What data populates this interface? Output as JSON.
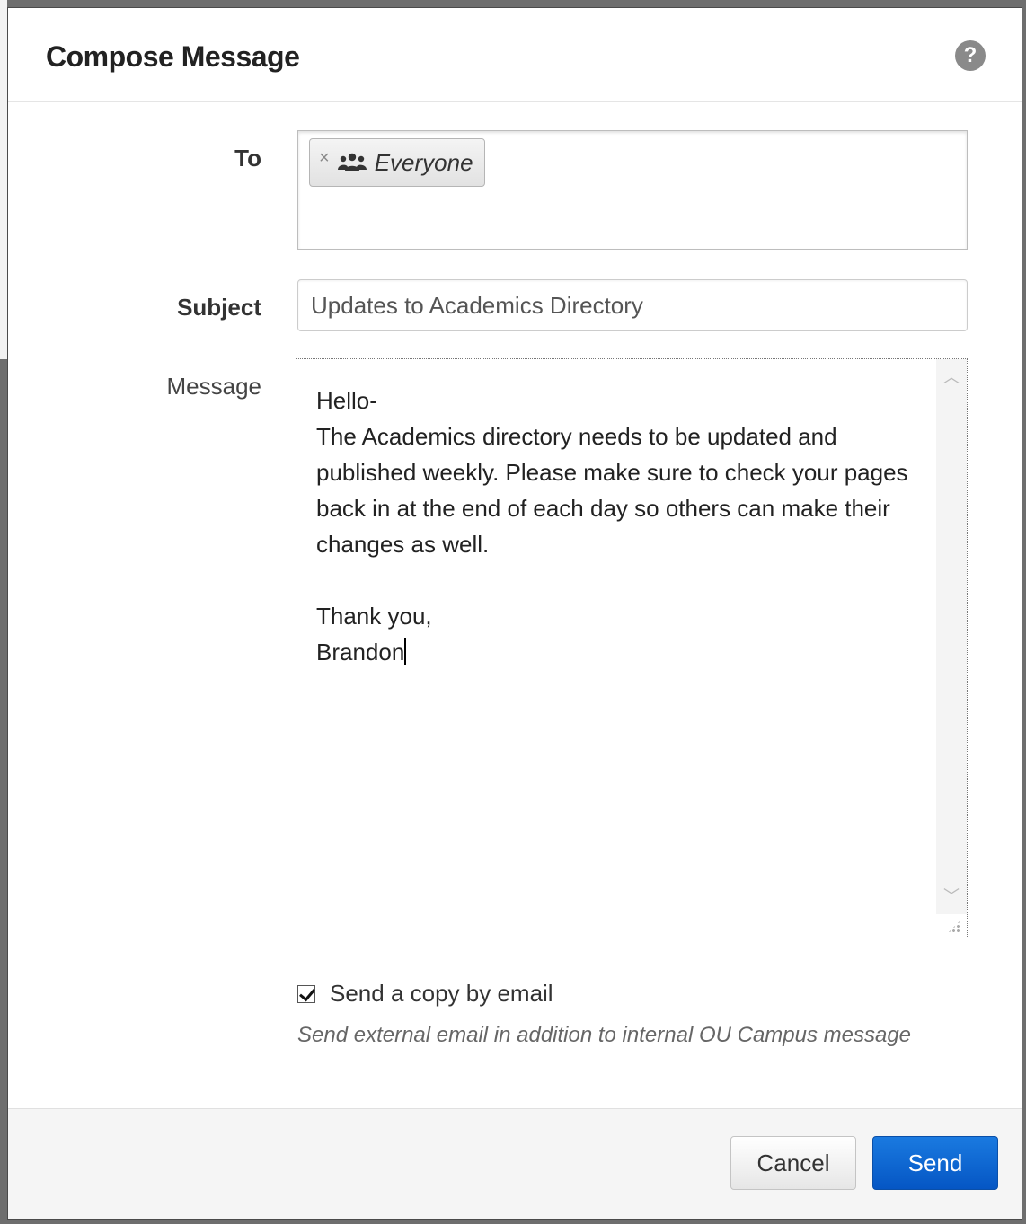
{
  "dialog": {
    "title": "Compose Message",
    "help_icon": "question-circle-icon"
  },
  "form": {
    "to_label": "To",
    "recipients": [
      {
        "name": "Everyone",
        "icon": "group-icon",
        "remove_symbol": "×"
      }
    ],
    "subject_label": "Subject",
    "subject_value": "Updates to Academics Directory",
    "message_label": "Message",
    "message_body": "Hello-\nThe Academics directory needs to be updated and published weekly. Please make sure to check your pages back in at the end of each day so others can make their changes as well.\n\nThank you,\nBrandon",
    "send_copy_label": "Send a copy by email",
    "send_copy_checked": true,
    "send_copy_help": "Send external email in addition to internal OU Campus message"
  },
  "footer": {
    "cancel_label": "Cancel",
    "send_label": "Send",
    "send_color": "#0a63d0"
  }
}
